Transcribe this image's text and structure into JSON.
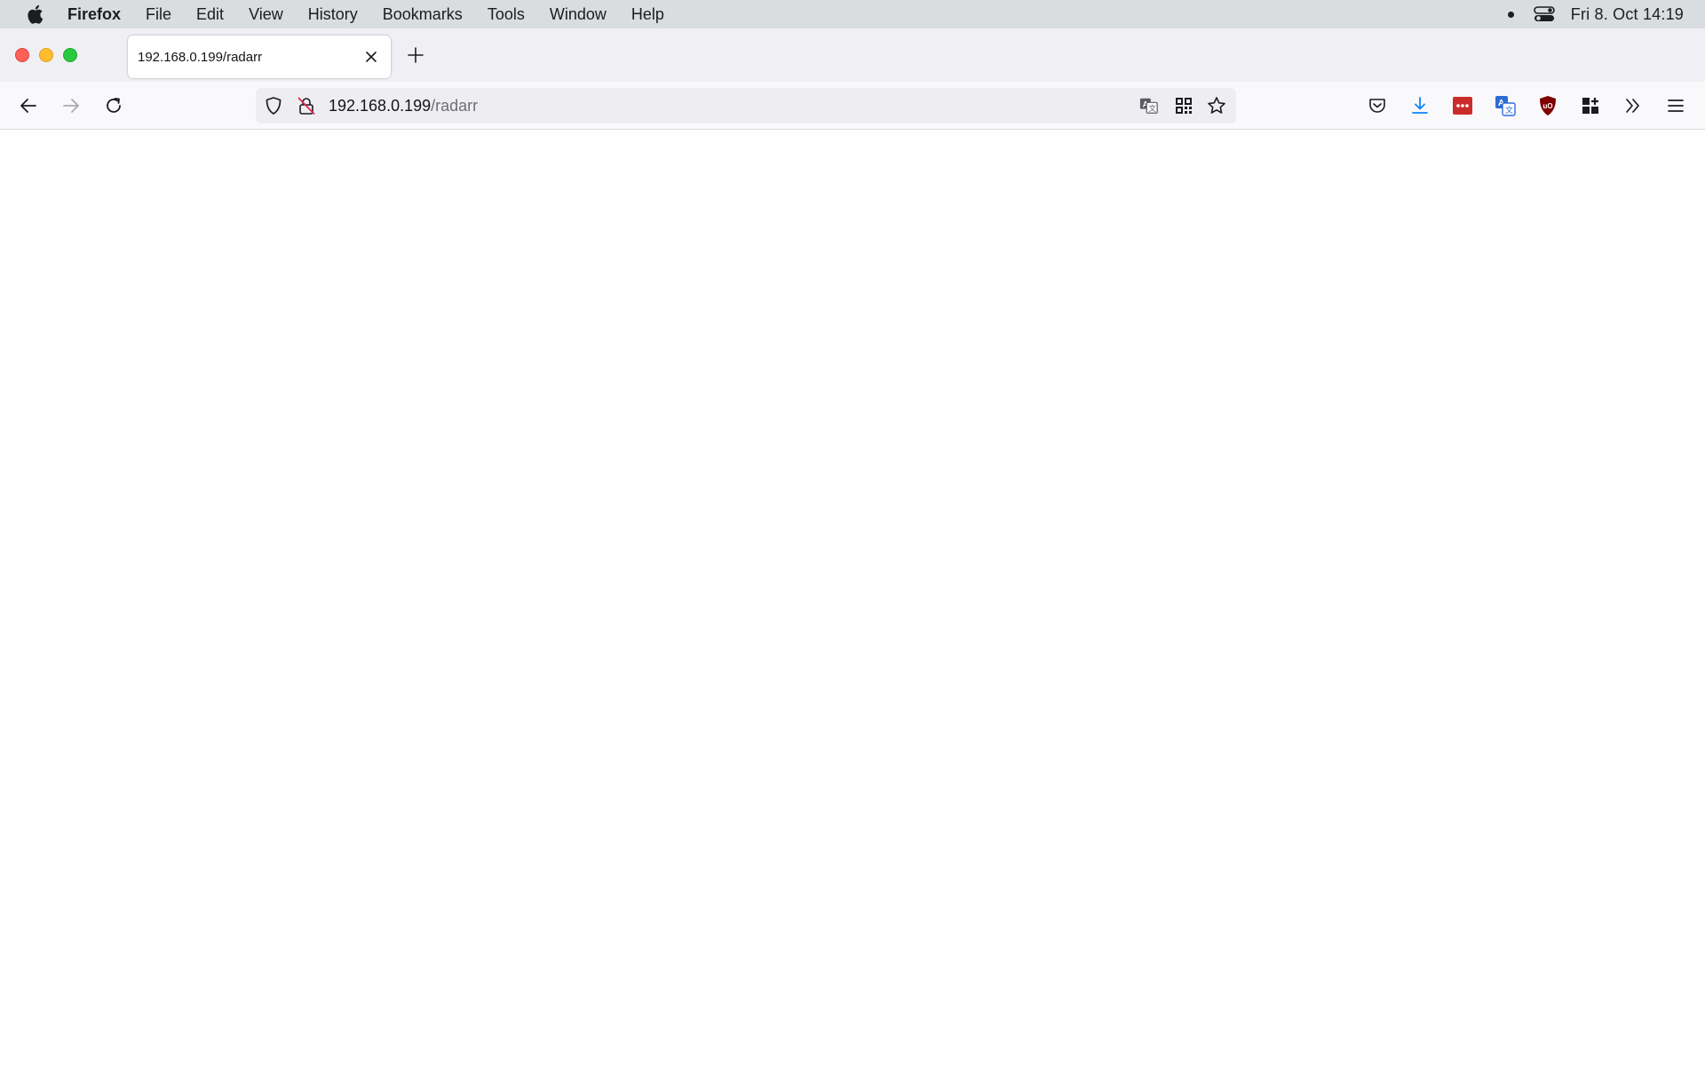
{
  "menubar": {
    "app_name": "Firefox",
    "items": [
      "File",
      "Edit",
      "View",
      "History",
      "Bookmarks",
      "Tools",
      "Window",
      "Help"
    ],
    "clock": "Fri 8. Oct  14:19"
  },
  "tab": {
    "title": "192.168.0.199/radarr"
  },
  "urlbar": {
    "host": "192.168.0.199",
    "path": "/radarr"
  },
  "icons": {
    "apple": "apple-logo-icon",
    "control_center": "control-center-icon",
    "tab_close": "close-icon",
    "new_tab": "plus-icon",
    "back": "arrow-left-icon",
    "forward": "arrow-right-icon",
    "reload": "reload-icon",
    "tracking": "shield-icon",
    "insecure": "insecure-lock-icon",
    "translate": "translate-icon",
    "qr": "qr-code-icon",
    "bookmark": "star-icon",
    "pocket": "pocket-icon",
    "downloads": "download-icon",
    "lastpass": "lastpass-icon",
    "translator": "translator-extension-icon",
    "ublock": "ublock-icon",
    "extensions": "extensions-icon",
    "overflow": "overflow-chevrons-icon",
    "menu": "hamburger-menu-icon"
  },
  "colors": {
    "menubar_bg": "#d9dde0",
    "tabstrip_bg": "#f0f0f4",
    "toolbar_bg": "#f9f9fb",
    "downloads_accent": "#0a84ff",
    "lastpass_red": "#cc2b2b",
    "ublock_red": "#800000"
  }
}
